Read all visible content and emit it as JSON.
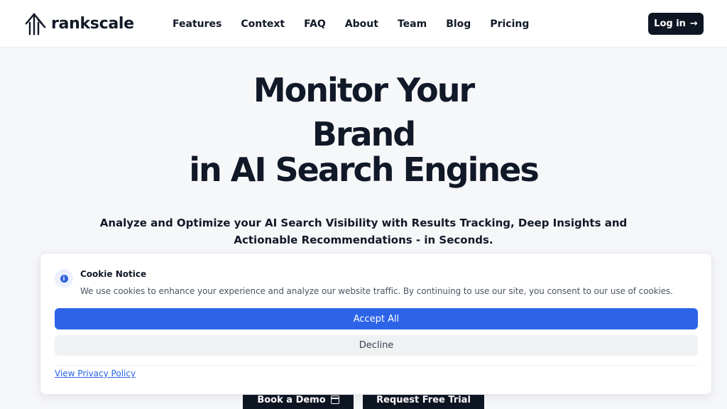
{
  "brand": {
    "name": "rankscale",
    "logo_icon": "rankscale-logo-icon"
  },
  "nav": {
    "links": [
      "Features",
      "Context",
      "FAQ",
      "About",
      "Team",
      "Blog",
      "Pricing"
    ],
    "login_label": "Log in",
    "login_icon": "arrow-right-icon"
  },
  "hero": {
    "line1": "Monitor Your",
    "line2": "Brand",
    "line3": "in AI Search Engines",
    "subtitle_line1": "Analyze and Optimize your AI Search Visibility with Results Tracking, Deep Insights and",
    "subtitle_line2": "Actionable Recommendations - in Seconds."
  },
  "cta": {
    "demo_label": "Book a Demo",
    "demo_icon": "calendar-icon",
    "trial_label": "Request Free Trial"
  },
  "cookie": {
    "icon": "info-icon",
    "title": "Cookie Notice",
    "message": "We use cookies to enhance your experience and analyze our website traffic. By continuing to use our site, you consent to our use of cookies.",
    "accept_label": "Accept All",
    "decline_label": "Decline",
    "privacy_label": "View Privacy Policy"
  },
  "colors": {
    "primary": "#2d64e7",
    "dark": "#0f1623",
    "background": "#f6f7f9"
  }
}
